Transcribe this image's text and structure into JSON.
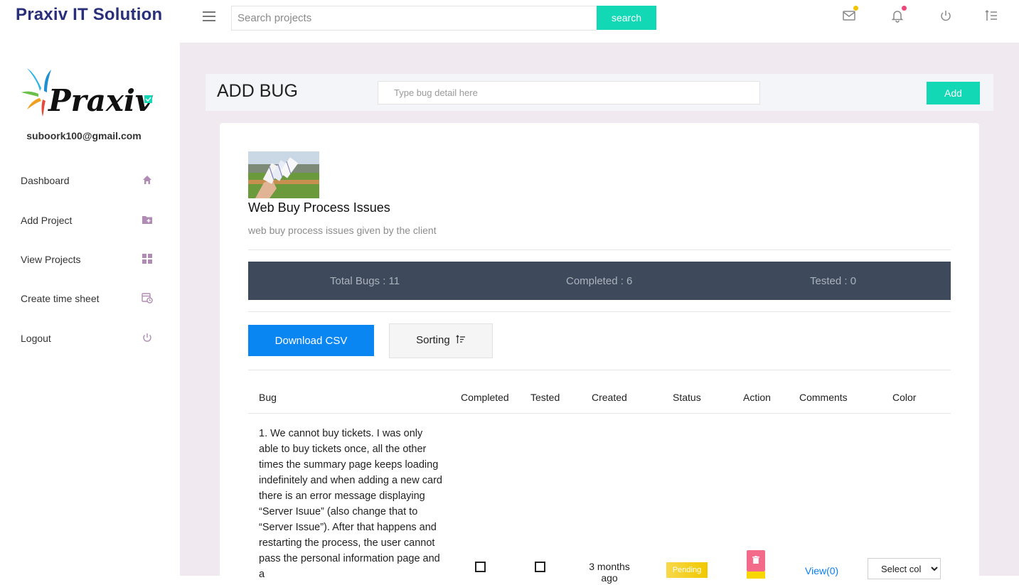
{
  "app": {
    "brand": "Praxiv IT Solution"
  },
  "search": {
    "placeholder": "Search projects",
    "button_label": "search"
  },
  "topbar_icons": [
    {
      "name": "mail-icon",
      "dot_color": "#f5c400"
    },
    {
      "name": "bell-icon",
      "dot_color": "#f0477a"
    },
    {
      "name": "power-icon"
    },
    {
      "name": "sort-lines-icon"
    }
  ],
  "sidebar": {
    "logo_text": "Praxiv",
    "user_email": "suboork100@gmail.com",
    "items": [
      {
        "label": "Dashboard",
        "icon": "home-icon"
      },
      {
        "label": "Add Project",
        "icon": "folder-add-icon"
      },
      {
        "label": "View Projects",
        "icon": "grid-icon"
      },
      {
        "label": "Create time sheet",
        "icon": "calendar-clock-icon"
      },
      {
        "label": "Logout",
        "icon": "power-icon"
      }
    ],
    "icon_color": "#b08cb4"
  },
  "add_bug": {
    "title": "ADD BUG",
    "input_placeholder": "Type bug detail here",
    "button_label": "Add"
  },
  "project": {
    "title": "Web Buy Process Issues",
    "description": "web buy process issues given by the client"
  },
  "stats": {
    "total": "Total Bugs : 11",
    "completed": "Completed : 6",
    "tested": "Tested : 0"
  },
  "actions": {
    "download_csv": "Download CSV",
    "sorting": "Sorting"
  },
  "table": {
    "headers": [
      "Bug",
      "Completed",
      "Tested",
      "Created",
      "Status",
      "Action",
      "Comments",
      "Color"
    ],
    "rows": [
      {
        "bug": "1. We cannot buy tickets. I was only able to buy tickets once, all the other times the summary page keeps loading indefinitely and when adding a new card there is an error message displaying “Server Isuue” (also change that to “Server Issue”). After that happens and restarting the process, the user cannot pass the personal information page and a",
        "created": "3 months ago",
        "status": "Pending",
        "comments": "View(0)",
        "color_select": "Select col"
      }
    ]
  },
  "colors": {
    "brand_text": "#2a2f7a",
    "accent_teal": "#12d8b6",
    "main_bg": "#f0e9f0",
    "stats_bg": "#3e4a5b",
    "csv_blue": "#0a86f2",
    "status_pending": "#f0c800",
    "delete_pink": "#f36a8b",
    "link_blue": "#0a7ff2"
  }
}
